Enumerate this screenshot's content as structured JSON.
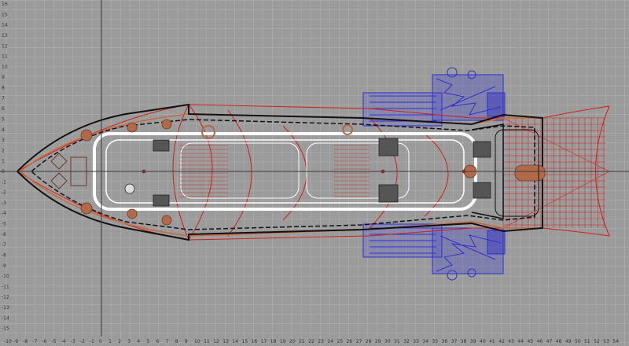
{
  "viewport": {
    "name": "top-orthographic-viewport",
    "axis_x_labels": [
      "-10",
      "-9",
      "-8",
      "-7",
      "-6",
      "-5",
      "-4",
      "-3",
      "-2",
      "-1",
      "0",
      "1",
      "2",
      "3",
      "4",
      "5",
      "6",
      "7",
      "8",
      "9",
      "10",
      "11",
      "12",
      "13",
      "14",
      "15",
      "16",
      "17",
      "18",
      "19",
      "20",
      "21",
      "22",
      "23",
      "24",
      "25",
      "26",
      "27",
      "28",
      "29",
      "30",
      "31",
      "32",
      "33",
      "34",
      "35",
      "36",
      "37",
      "38",
      "39",
      "40",
      "41",
      "42",
      "43",
      "44",
      "45",
      "46",
      "47",
      "48",
      "49",
      "50",
      "51",
      "52",
      "53",
      "54"
    ],
    "axis_y_labels": [
      "16",
      "15",
      "14",
      "13",
      "12",
      "11",
      "10",
      "9",
      "8",
      "7",
      "6",
      "5",
      "4",
      "3",
      "2",
      "1",
      "0",
      "-1",
      "-2",
      "-3",
      "-4",
      "-5",
      "-6",
      "-7",
      "-8",
      "-9",
      "-10",
      "-11",
      "-12",
      "-13",
      "-14",
      "-15",
      "-16"
    ]
  },
  "colors": {
    "background": "#9b9b9b",
    "grid_minor": "#b0b0b0",
    "grid_major": "#7c7c7c",
    "origin_axis": "#3a3a3a",
    "hull_black": "#111111",
    "hull_red": "#d0201a",
    "hull_orange": "#c86a3a",
    "deck_white": "#ffffff",
    "engine_blue": "#2f2fd0",
    "fixture_brown": "#b06a4a"
  },
  "icons": [
    "propeller-icon",
    "engine-icon",
    "anchor-winch-icon"
  ]
}
